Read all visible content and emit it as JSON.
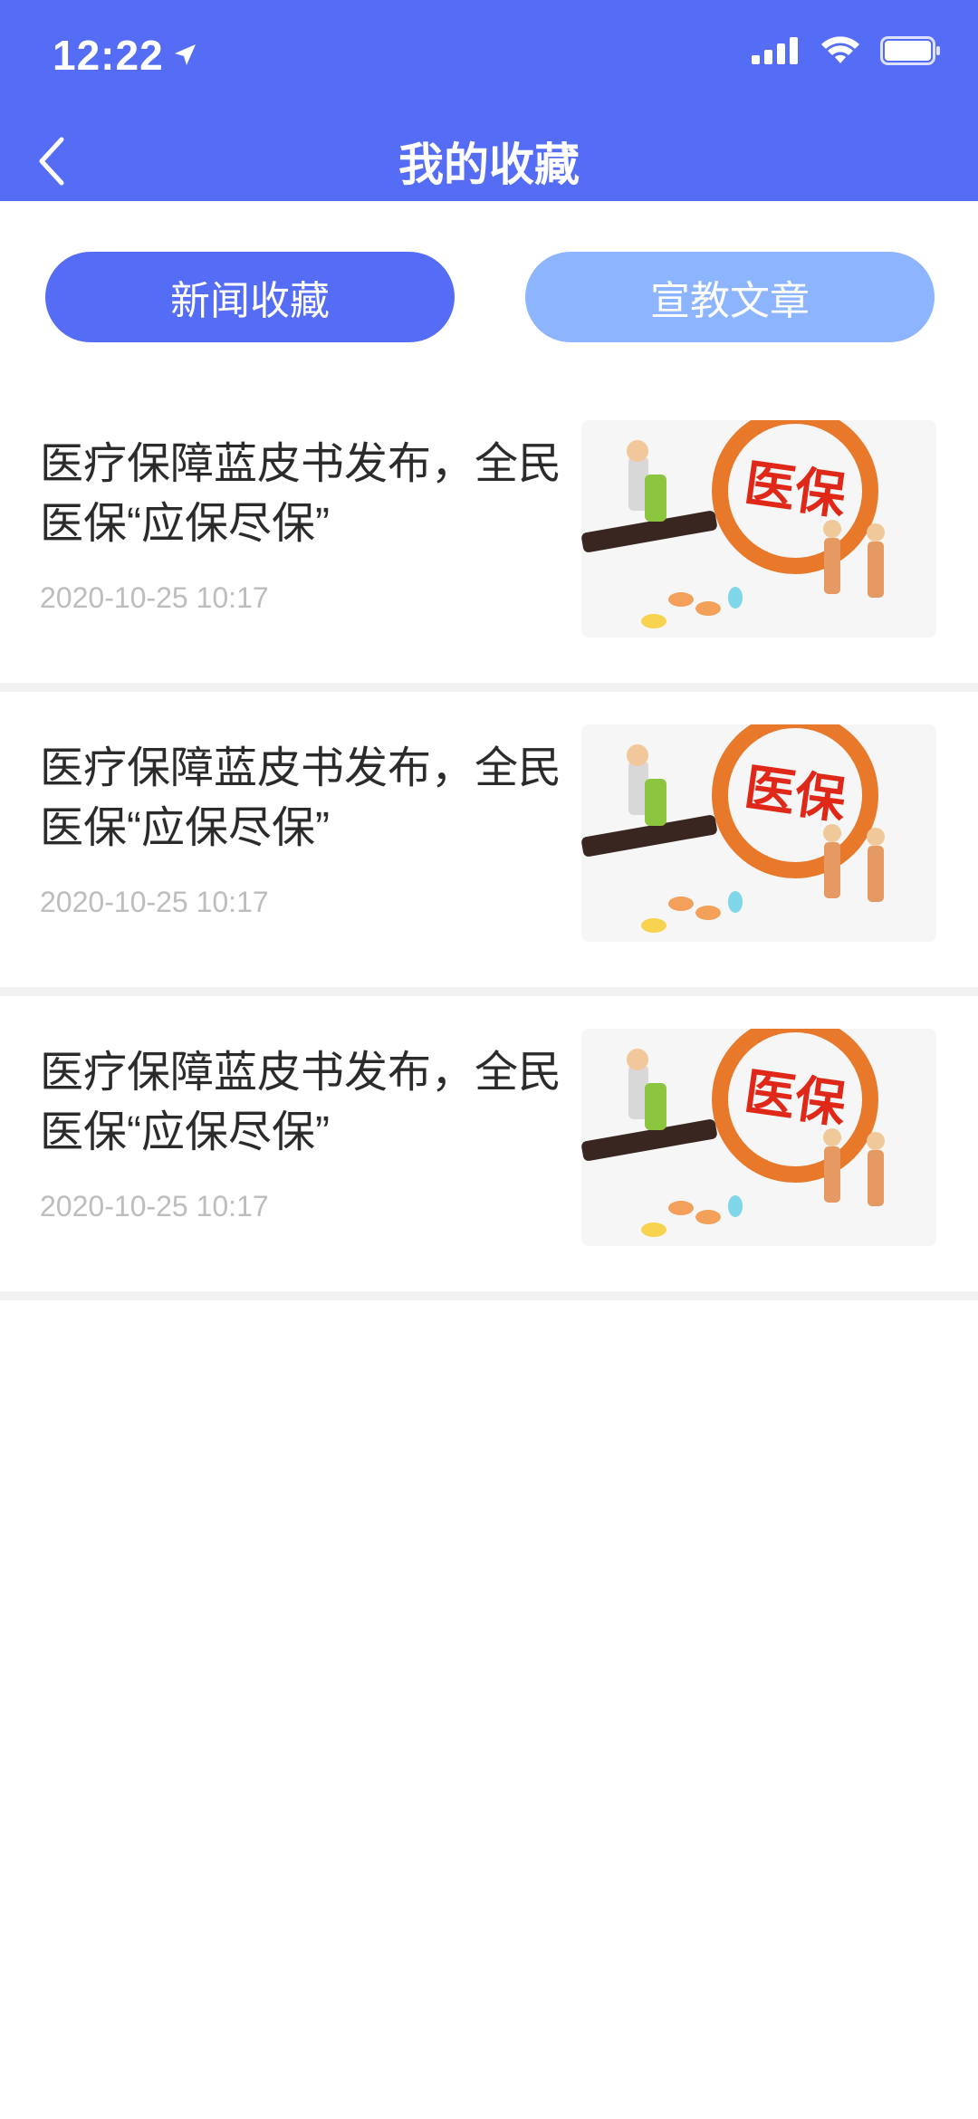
{
  "status_bar": {
    "time": "12:22"
  },
  "nav": {
    "title": "我的收藏"
  },
  "tabs": [
    {
      "label": "新闻收藏",
      "active": true
    },
    {
      "label": "宣教文章",
      "active": false
    }
  ],
  "articles": [
    {
      "title": "医疗保障蓝皮书发布，全民医保“应保尽保”",
      "time": "2020-10-25 10:17",
      "image_text": "医保"
    },
    {
      "title": "医疗保障蓝皮书发布，全民医保“应保尽保”",
      "time": "2020-10-25 10:17",
      "image_text": "医保"
    },
    {
      "title": "医疗保障蓝皮书发布，全民医保“应保尽保”",
      "time": "2020-10-25 10:17",
      "image_text": "医保"
    }
  ],
  "colors": {
    "primary": "#556cf4",
    "tab_inactive": "#8cb4ff"
  }
}
